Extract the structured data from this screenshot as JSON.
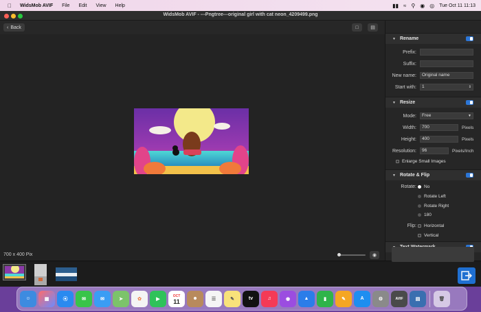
{
  "menubar": {
    "app_name": "WidsMob AVIF",
    "menus": [
      "File",
      "Edit",
      "View",
      "Help"
    ],
    "clock": "Tue Oct 11  11:13"
  },
  "window": {
    "title": "WidsMob AVIF - ---Pngtree---original girl with cat neon_4209499.png",
    "back_label": "Back",
    "image_size_label": "700 x 400 Pix"
  },
  "panel": {
    "rename": {
      "title": "Rename",
      "prefix_label": "Prefix:",
      "prefix_value": "",
      "suffix_label": "Suffix:",
      "suffix_value": "",
      "new_name_label": "New name:",
      "new_name_value": "Original name",
      "start_with_label": "Start with:",
      "start_with_value": "1"
    },
    "resize": {
      "title": "Resize",
      "mode_label": "Mode:",
      "mode_value": "Free",
      "width_label": "Width:",
      "width_value": "700",
      "width_unit": "Pixels",
      "height_label": "Height:",
      "height_value": "400",
      "height_unit": "Pixels",
      "resolution_label": "Resolution:",
      "resolution_value": "96",
      "resolution_unit": "Pixels/Inch",
      "enlarge_label": "Enlarge Small Images"
    },
    "rotate": {
      "title": "Rotate & Flip",
      "rotate_label": "Rotate:",
      "options": [
        "No",
        "Rotate Left",
        "Rotate Right",
        "180"
      ],
      "selected": "No",
      "flip_label": "Flip:",
      "flip_options": [
        "Horizontal",
        "Vertical"
      ]
    },
    "watermark": {
      "title": "Text Watermark"
    }
  },
  "dock": {
    "calendar_month": "OCT",
    "calendar_day": "11",
    "avif_label": "AVIF"
  },
  "colors": {
    "accent": "#2c76d6",
    "export": "#1f6fd1"
  }
}
